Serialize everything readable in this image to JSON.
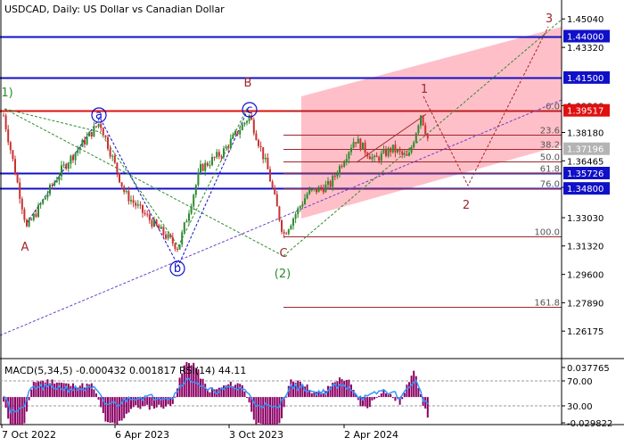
{
  "chart_data": {
    "type": "candlestick",
    "symbol": "USDCAD",
    "timeframe": "Daily",
    "title": "USDCAD, Daily:  US Dollar vs Canadian Dollar",
    "price_axis": {
      "range": [
        1.24622,
        1.46184
      ],
      "ticks": [
        "1.45040",
        "1.43320",
        "1.39800",
        "1.38180",
        "1.36465",
        "1.34860",
        "1.33030",
        "1.31320",
        "1.29600",
        "1.27890",
        "1.26175"
      ]
    },
    "price_labels": [
      {
        "text": "1.44000",
        "value": 1.44,
        "color": "#1010c8"
      },
      {
        "text": "1.41500",
        "value": 1.415,
        "color": "#1010c8"
      },
      {
        "text": "1.39517",
        "value": 1.39517,
        "color": "#e01010"
      },
      {
        "text": "1.37196",
        "value": 1.37196,
        "color": "#b4b4b4"
      },
      {
        "text": "1.35726",
        "value": 1.35726,
        "color": "#1010c8"
      },
      {
        "text": "1.34800",
        "value": 1.348,
        "color": "#1010c8"
      }
    ],
    "horizontal_levels": [
      {
        "value": 1.44,
        "color": "#1010c8"
      },
      {
        "value": 1.415,
        "color": "#1010c8"
      },
      {
        "value": 1.39517,
        "color": "#e01010"
      },
      {
        "value": 1.35726,
        "color": "#1010c8"
      },
      {
        "value": 1.348,
        "color": "#1010c8"
      }
    ],
    "fibonacci": {
      "levels": [
        {
          "label": "0.0",
          "value": 1.39517
        },
        {
          "label": "23.6",
          "value": 1.3805
        },
        {
          "label": "38.2",
          "value": 1.37196
        },
        {
          "label": "50.0",
          "value": 1.36434
        },
        {
          "label": "61.8",
          "value": 1.35726
        },
        {
          "label": "76.0",
          "value": 1.348
        },
        {
          "label": "100.0",
          "value": 1.3192
        },
        {
          "label": "161.8",
          "value": 1.2762
        }
      ]
    },
    "wave_labels": [
      {
        "text": "1)",
        "color": "#2e8b2e"
      },
      {
        "text": "A",
        "color": "#a0262a"
      },
      {
        "text": "a",
        "color": "#1010c8",
        "circled": true
      },
      {
        "text": "b",
        "color": "#1010c8",
        "circled": true
      },
      {
        "text": "B",
        "color": "#a0262a"
      },
      {
        "text": "c",
        "color": "#1010c8",
        "circled": true
      },
      {
        "text": "C",
        "color": "#a0262a"
      },
      {
        "text": "(2)",
        "color": "#2e8b2e"
      },
      {
        "text": "1",
        "color": "#a0262a"
      },
      {
        "text": "2",
        "color": "#a0262a"
      },
      {
        "text": "3",
        "color": "#a0262a"
      }
    ],
    "x_axis": {
      "labels": [
        "7 Oct 2022",
        "6 Apr 2023",
        "3 Oct 2023",
        "2 Apr 2024"
      ]
    },
    "indicator_panel": {
      "header": "MACD(5,34,5) -0.000432 0.001817 RSI(14) 44.11",
      "macd": {
        "value": -0.000432,
        "signal": 0.001817,
        "range": [
          -0.029822,
          0.037765
        ]
      },
      "rsi": {
        "value": 44.11
      },
      "axis_labels": [
        "0.037765",
        "70.00",
        "30.00",
        "-0.029822"
      ]
    },
    "colors": {
      "bull": "#2e8b2e",
      "bear": "#c83232",
      "channel": "#ffb4be",
      "macd_hist": "#8b0064",
      "rsi": "#3296ff",
      "wave_label": "#a0262a"
    }
  }
}
